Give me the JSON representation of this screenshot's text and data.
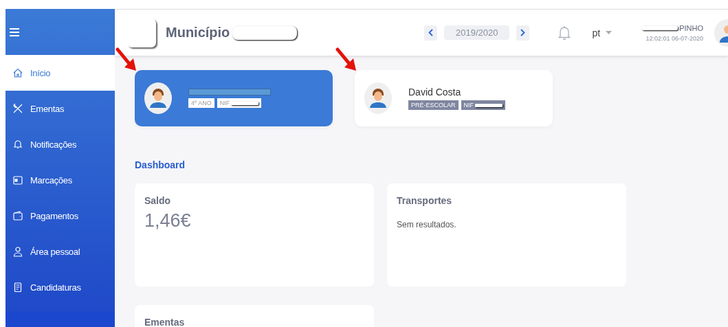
{
  "sidebar": {
    "items": [
      {
        "label": "Início",
        "selected": true
      },
      {
        "label": "Ementas",
        "selected": false
      },
      {
        "label": "Notificações",
        "selected": false
      },
      {
        "label": "Marcações",
        "selected": false
      },
      {
        "label": "Pagamentos",
        "selected": false
      },
      {
        "label": "Área pessoal",
        "selected": false
      },
      {
        "label": "Candidaturas",
        "selected": false
      }
    ]
  },
  "header": {
    "title": "Município",
    "year": "2019/2020",
    "language": "pt",
    "user_name": "PINHO",
    "timestamp": "12:02:01 06-07-2020"
  },
  "students": [
    {
      "selected": true,
      "annotated": true,
      "badges": [
        "4º ANO",
        "NIF"
      ]
    },
    {
      "name": "David Costa",
      "selected": false,
      "annotated": true,
      "badges": [
        "PRÉ-ESCOLAR",
        "NIF"
      ]
    }
  ],
  "dashboard": {
    "title": "Dashboard",
    "cards": [
      {
        "title": "Saldo",
        "value": "1,46€"
      },
      {
        "title": "Transportes",
        "text": "Sem resultados."
      },
      {
        "title": "Ementas"
      }
    ]
  }
}
